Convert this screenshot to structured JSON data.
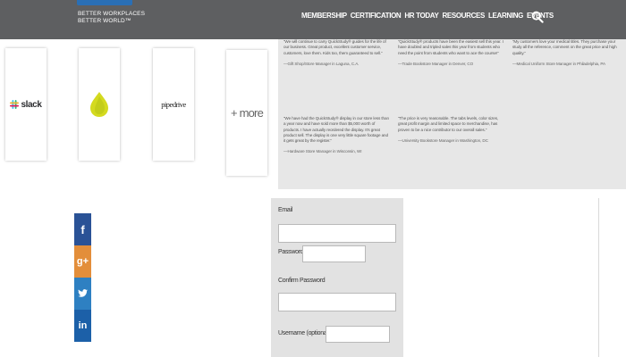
{
  "header": {
    "logo_line1": "BETTER WORKPLACES",
    "logo_line2": "BETTER WORLD™",
    "nav": [
      "MEMBERSHIP",
      "CERTIFICATION",
      "HR TODAY",
      "RESOURCES",
      "LEARNING",
      "EVENTS"
    ],
    "search_icon": "search-icon",
    "colors": {
      "bar": "#5e5f61",
      "logo": "#2a6fb5"
    }
  },
  "apps": {
    "slack": "slack",
    "pipedrive": "pipedrive",
    "more": "+ more"
  },
  "testimonials": [
    {
      "quote": "“We will continue to carry QuickStudy® guides for the life of our business. Great product, excellent customer service, customers, love them. Kids too, them guaranteed to sell.”",
      "attr": "—Gift Shop/Store Manager in Laguna, C.A."
    },
    {
      "quote": "“QuickStudy® products have been the easiest sell this year. I have doubled and tripled sales this year from students who need the point from students who want to ace the course!”",
      "attr": "—Trade Bookstore Manager in Denver, CO"
    },
    {
      "quote": "“My customers love your medical titles. They purchase your study all the reference, comment on the great price and high quality.”",
      "attr": "—Medical Uniform Store Manager in Philadelphia, PA"
    },
    {
      "quote": "“We have had the QuickStudy® display in our store less than a year now and have sold more than $5,000 worth of products. I have actually reordered the display. It's great product sell. The display is one very little square footage and it gets great by the register.”",
      "attr": "—Hardware Store Manager in Wisconsin, WI"
    },
    {
      "quote": "“The price is very reasonable. The tabs levels, color sizes, great profit margin and limited space to merchandise, has proven to be a nice contributor to our overall sales.”",
      "attr": "—University Bookstore Manager in Washington, DC"
    }
  ],
  "share": [
    {
      "name": "facebook",
      "glyph": "f"
    },
    {
      "name": "google-plus",
      "glyph": "g+"
    },
    {
      "name": "twitter",
      "glyph": "t"
    },
    {
      "name": "linkedin",
      "glyph": "in"
    }
  ],
  "form": {
    "email_label": "Email",
    "email_value": "",
    "password_label": "Password",
    "password_value": "",
    "confirm_label": "Confirm Password",
    "confirm_value": "",
    "username_label": "Username (optional)",
    "username_value": ""
  }
}
